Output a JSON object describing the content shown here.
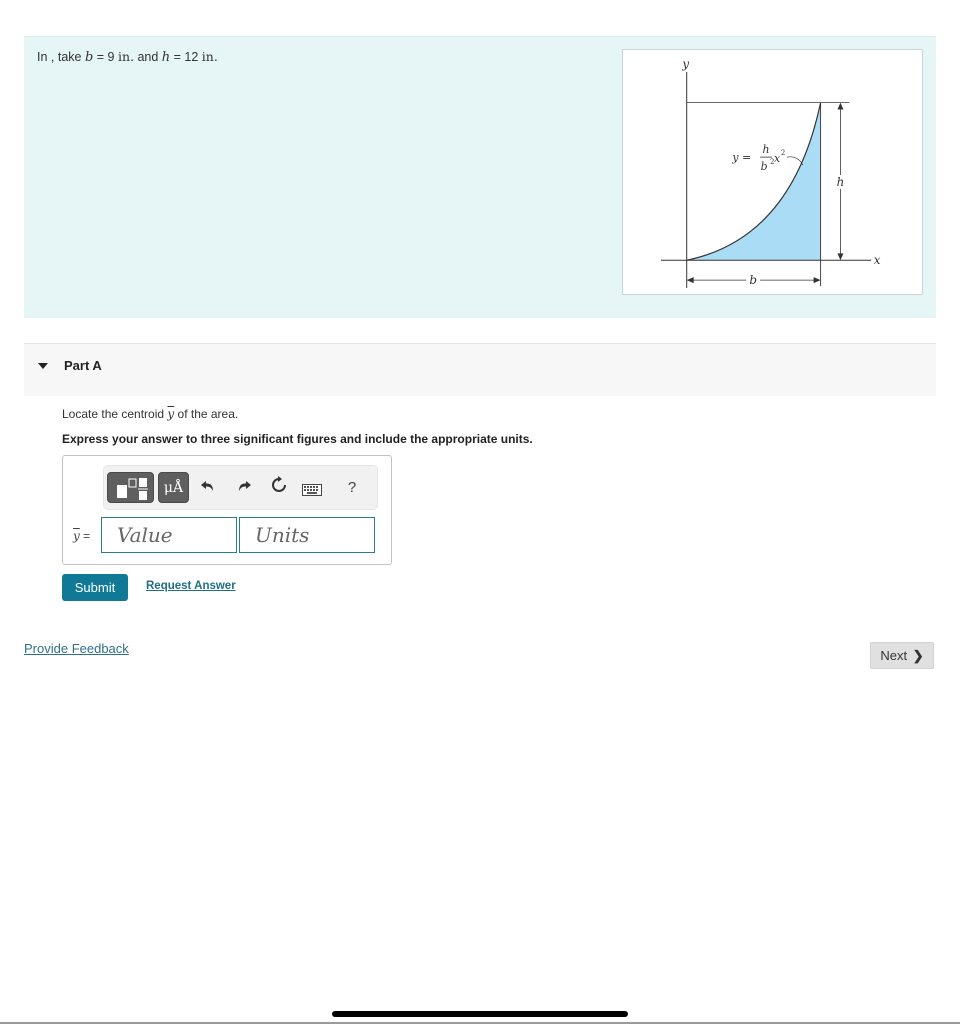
{
  "problem": {
    "prefix": "In , take ",
    "b_var": "b",
    "b_eq": " = 9 ",
    "b_unit": "in.",
    "and": " and ",
    "h_var": "h",
    "h_eq": " = 12 ",
    "h_unit": "in."
  },
  "figure": {
    "y_axis_label": "y",
    "x_axis_label": "x",
    "equation_lhs": "y =",
    "equation_num": "h",
    "equation_den": "b",
    "equation_den_exp": "2",
    "equation_var": "x",
    "equation_var_exp": "2",
    "height_label": "h",
    "width_label": "b",
    "fill_color": "#aadcf5"
  },
  "part": {
    "title": "Part A",
    "instruction_prefix": "Locate the centroid ",
    "instruction_var": "y",
    "instruction_suffix": " of the area.",
    "express": "Express your answer to three significant figures and include the appropriate units."
  },
  "toolbar": {
    "template_icon": "templates-icon",
    "units_label": "μÅ",
    "undo_icon": "↶",
    "redo_icon": "↷",
    "reset_icon": "↻",
    "keyboard_icon": "⌨",
    "help_label": "?"
  },
  "answer": {
    "label_var": "y",
    "label_eq": " =",
    "value_placeholder": "Value",
    "units_placeholder": "Units",
    "value": "",
    "units": ""
  },
  "actions": {
    "submit": "Submit",
    "request_answer": "Request Answer",
    "provide_feedback": "Provide Feedback",
    "next": "Next",
    "next_chevron": "❯"
  },
  "colors": {
    "accent": "#107a96",
    "panel_bg": "#e6f5f6",
    "link": "#1f6f86"
  }
}
